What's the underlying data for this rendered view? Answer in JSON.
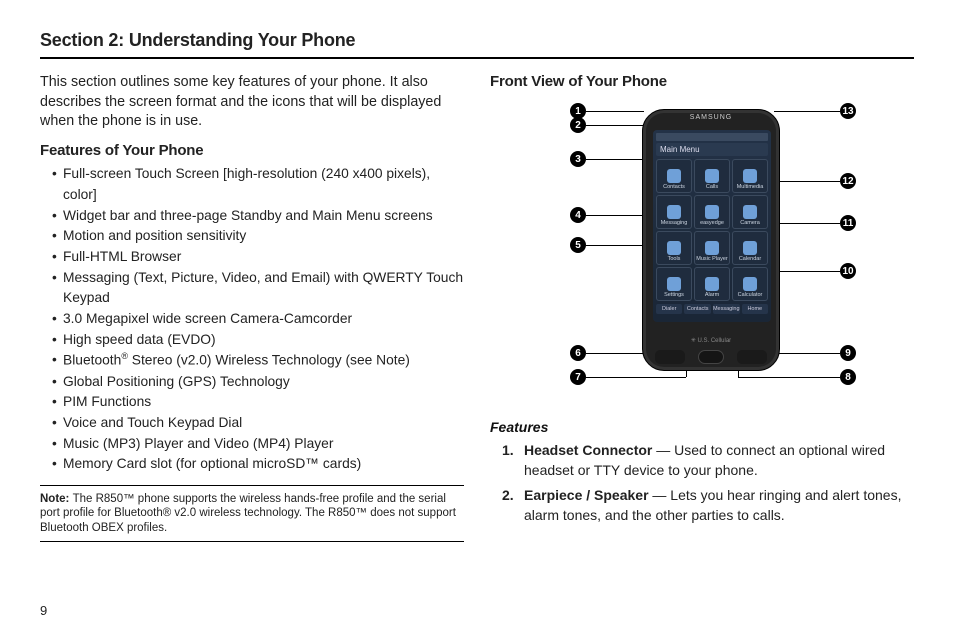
{
  "section_title": "Section 2: Understanding Your Phone",
  "intro": "This section outlines some key features of your phone. It also describes the screen format and the icons that will be displayed when the phone is in use.",
  "features_heading": "Features of Your Phone",
  "features": [
    "Full-screen Touch Screen [high-resolution (240 x400 pixels), color]",
    "Widget bar and three-page Standby and Main Menu screens",
    "Motion and position sensitivity",
    "Full-HTML Browser",
    "Messaging (Text, Picture, Video, and Email) with QWERTY Touch Keypad",
    "3.0 Megapixel wide screen Camera-Camcorder",
    "High speed data (EVDO)",
    "Bluetooth® Stereo (v2.0) Wireless Technology (see Note)",
    "Global Positioning (GPS) Technology",
    "PIM Functions",
    "Voice and Touch Keypad Dial",
    "Music (MP3) Player and Video (MP4) Player",
    " Memory Card slot (for optional microSD™ cards)"
  ],
  "note_label": "Note: ",
  "note_body": "The R850™ phone supports the wireless hands-free profile and the serial port profile for Bluetooth® v2.0 wireless technology. The R850™ does not support Bluetooth OBEX profiles.",
  "front_view_heading": "Front View of Your Phone",
  "phone": {
    "brand": "SAMSUNG",
    "menu_title": "Main Menu",
    "apps": [
      "Contacts",
      "Calls",
      "Multimedia",
      "Messaging",
      "easyedge",
      "Camera",
      "Tools",
      "Music Player",
      "Calendar",
      "Settings",
      "Alarm",
      "Calculator"
    ],
    "bottom_tabs": [
      "Dialer",
      "Contacts",
      "Messaging",
      "Home"
    ],
    "carrier": "✳ U.S. Cellular"
  },
  "callouts": [
    "1",
    "2",
    "3",
    "4",
    "5",
    "6",
    "7",
    "8",
    "9",
    "10",
    "11",
    "12",
    "13"
  ],
  "features_sub_label": "Features",
  "numbered": [
    {
      "n": "1.",
      "name": "Headset Connector",
      "desc": " — Used to connect an optional wired headset or TTY device to your phone."
    },
    {
      "n": "2.",
      "name": "Earpiece / Speaker",
      "desc": " — Lets you hear ringing and alert tones, alarm tones, and the other parties to calls."
    }
  ],
  "page_number": "9"
}
